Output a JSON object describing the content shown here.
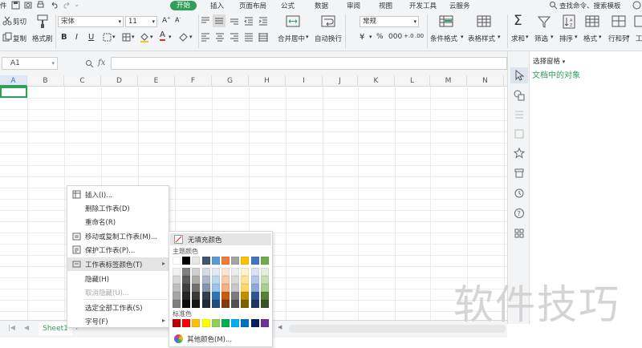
{
  "menu": {
    "tabs": [
      "件",
      "开始",
      "插入",
      "页面布局",
      "公式",
      "数据",
      "审阅",
      "视图",
      "开发工具",
      "云服务"
    ],
    "active_tab": "开始",
    "search_placeholder": "查找命令、搜索模板"
  },
  "ribbon": {
    "cut": "剪切",
    "copy": "复制",
    "format_painter": "格式刷",
    "font_name": "宋体",
    "font_size": "11",
    "merge_center": "合并居中",
    "wrap_text": "自动换行",
    "number_format": "常规",
    "conditional_format": "条件格式",
    "table_style": "表格样式",
    "sum": "求和",
    "filter": "筛选",
    "sort": "排序",
    "format": "格式",
    "rows_cols": "行和列",
    "work": "工"
  },
  "formula_bar": {
    "name_box": "A1",
    "fx": "fx"
  },
  "grid": {
    "columns": [
      "A",
      "B",
      "C",
      "D",
      "E",
      "F",
      "G",
      "H",
      "I",
      "J",
      "K",
      "L",
      "M",
      "N"
    ],
    "selected_column": "A"
  },
  "selection_pane": {
    "title": "选择窗格",
    "subtitle": "文档中的对象"
  },
  "sheet_tabs": {
    "active": "Sheet1"
  },
  "context_menu": {
    "items": [
      {
        "label": "插入(I)...",
        "icon": "insert-sheet-icon"
      },
      {
        "label": "删除工作表(D)"
      },
      {
        "label": "重命名(R)"
      },
      {
        "label": "移动或复制工作表(M)...",
        "icon": "move-copy-icon"
      },
      {
        "label": "保护工作表(P)...",
        "icon": "protect-sheet-icon"
      },
      {
        "label": "工作表标签颜色(T)",
        "icon": "tab-color-icon",
        "submenu": true,
        "highlighted": true
      },
      {
        "label": "隐藏(H)"
      },
      {
        "label": "取消隐藏(U)...",
        "disabled": true
      },
      {
        "label": "选定全部工作表(S)"
      },
      {
        "label": "字号(F)",
        "submenu": true
      }
    ]
  },
  "color_submenu": {
    "no_fill": "无填充颜色",
    "theme_colors_label": "主题颜色",
    "standard_colors_label": "标准色",
    "more_colors": "其他颜色(M)...",
    "theme_top_row": [
      "#ffffff",
      "#000000",
      "#e7e6e6",
      "#44546a",
      "#5b9bd5",
      "#ed7d31",
      "#a5a5a5",
      "#ffc000",
      "#4472c4",
      "#70ad47"
    ],
    "theme_shades": [
      [
        "#f2f2f2",
        "#7f7f7f",
        "#d0cece",
        "#d6dce4",
        "#deebf6",
        "#fbe5d5",
        "#ededed",
        "#fff2cc",
        "#d9e2f3",
        "#e2efd9"
      ],
      [
        "#d8d8d8",
        "#595959",
        "#aeabab",
        "#adb9ca",
        "#bdd7ee",
        "#f7cbac",
        "#dbdbdb",
        "#fee599",
        "#b4c6e7",
        "#c5e0b3"
      ],
      [
        "#bfbfbf",
        "#3f3f3f",
        "#757070",
        "#8496b0",
        "#9dc3e6",
        "#f4b183",
        "#c9c9c9",
        "#ffd965",
        "#8eaadb",
        "#a8d08d"
      ],
      [
        "#a5a5a5",
        "#262626",
        "#3a3838",
        "#323f4f",
        "#2e75b5",
        "#c55a11",
        "#7b7b7b",
        "#bf9000",
        "#2f5496",
        "#538135"
      ],
      [
        "#7f7f7f",
        "#0c0c0c",
        "#171616",
        "#222a35",
        "#1e4e79",
        "#843c0b",
        "#525252",
        "#7f6000",
        "#1f3864",
        "#375623"
      ]
    ],
    "standard_colors": [
      "#c00000",
      "#ff0000",
      "#ffc000",
      "#ffff00",
      "#92d050",
      "#00b050",
      "#00b0f0",
      "#0070c0",
      "#002060",
      "#7030a0"
    ]
  },
  "watermark": "软件技巧",
  "colors": {
    "accent": "#2f9f5a",
    "ribbon_bg": "#f3f4f6"
  }
}
